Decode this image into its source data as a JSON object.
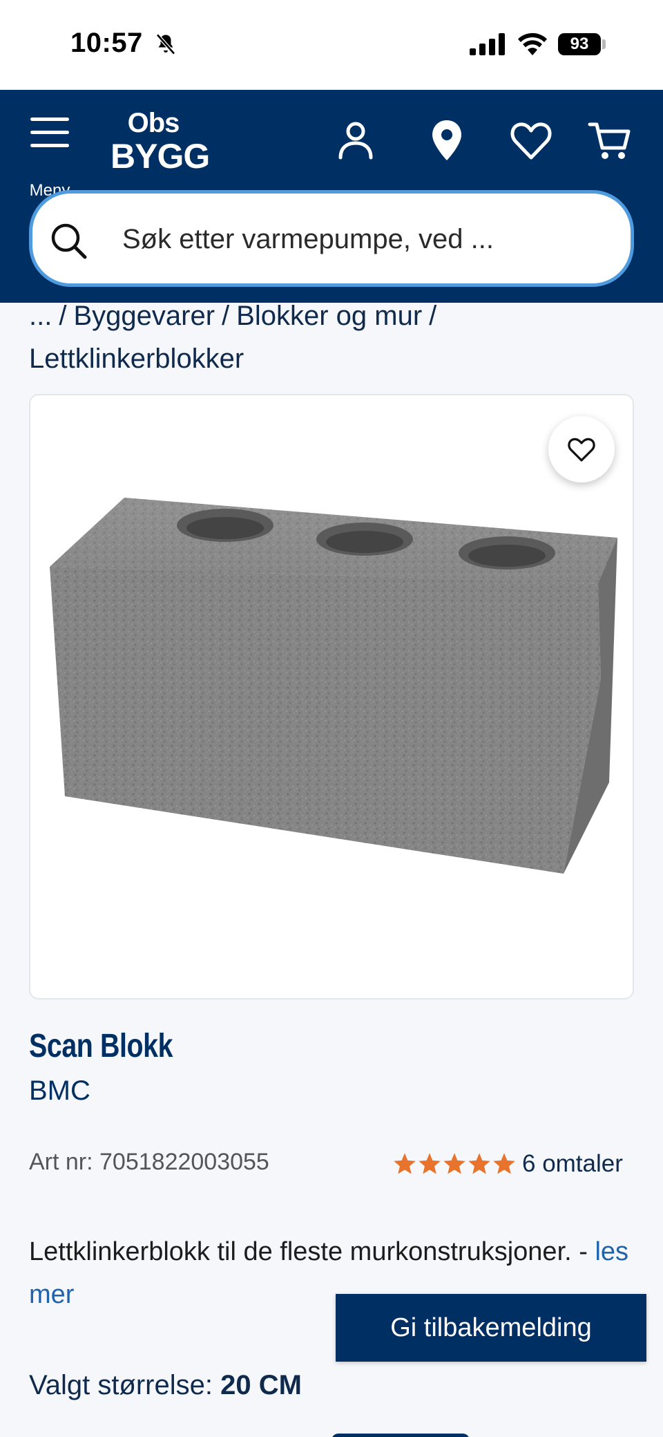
{
  "status_bar": {
    "time": "10:57",
    "battery": "93"
  },
  "header": {
    "menu_label": "Meny",
    "logo_top": "Obs",
    "logo_bottom": "BYGG",
    "search_placeholder": "Søk etter varmepumpe, ved ..."
  },
  "breadcrumb": {
    "items": [
      "...",
      "Byggevarer",
      "Blokker og mur",
      "Lettklinkerblokker"
    ],
    "separator": "/"
  },
  "product": {
    "name": "Scan Blokk",
    "brand": "BMC",
    "art_nr": "Art nr: 7051822003055",
    "rating": 5,
    "rating_max": 5,
    "reviews_label": "6 omtaler",
    "description": "Lettklinkerblokk til de fleste murkonstruksjoner. -",
    "read_more": "les mer",
    "size_label": "Valgt størrelse:",
    "size_value": "20 CM"
  },
  "feedback_button": "Gi tilbakemelding",
  "colors": {
    "navy": "#002f63",
    "search_border": "#4f9be0",
    "star": "#e8732c",
    "link": "#1f63ad"
  }
}
